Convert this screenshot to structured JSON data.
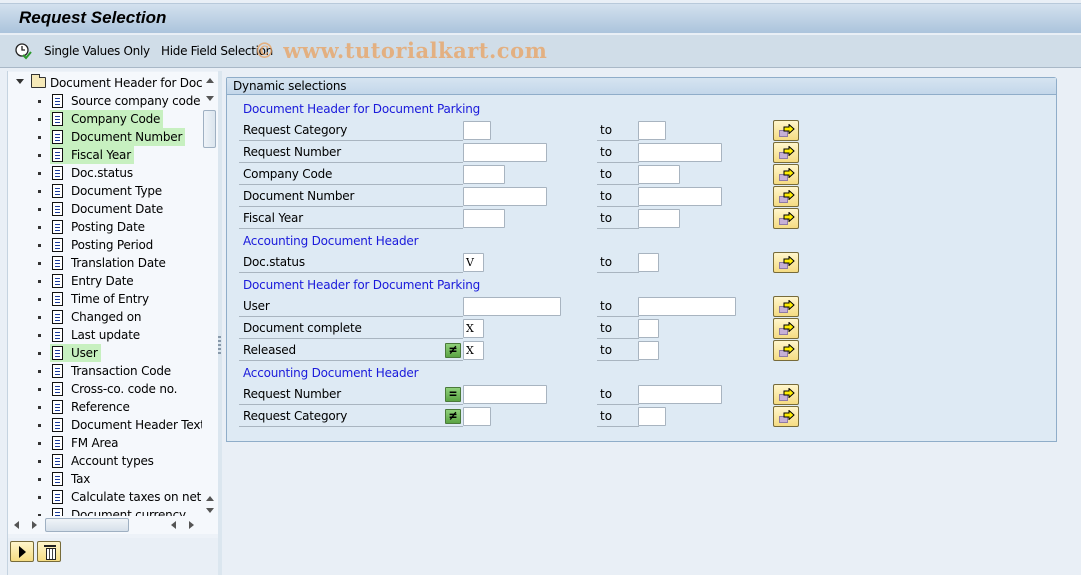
{
  "window": {
    "title": "Request Selection"
  },
  "toolbar": {
    "items": [
      {
        "label": "Single Values Only",
        "icon": "clock-check-icon"
      },
      {
        "label": "Hide Field Selection"
      }
    ],
    "watermark": "© www.tutorialkart.com"
  },
  "tree": {
    "root": {
      "label": "Document Header for Docu",
      "expanded": true
    },
    "items": [
      {
        "label": "Source company code",
        "selected": false
      },
      {
        "label": "Company Code",
        "selected": true
      },
      {
        "label": "Document Number",
        "selected": true
      },
      {
        "label": "Fiscal Year",
        "selected": true
      },
      {
        "label": "Doc.status",
        "selected": false
      },
      {
        "label": "Document Type",
        "selected": false
      },
      {
        "label": "Document Date",
        "selected": false
      },
      {
        "label": "Posting Date",
        "selected": false
      },
      {
        "label": "Posting Period",
        "selected": false
      },
      {
        "label": "Translation Date",
        "selected": false
      },
      {
        "label": "Entry Date",
        "selected": false
      },
      {
        "label": "Time of Entry",
        "selected": false
      },
      {
        "label": "Changed on",
        "selected": false
      },
      {
        "label": "Last update",
        "selected": false
      },
      {
        "label": "User",
        "selected": true
      },
      {
        "label": "Transaction Code",
        "selected": false
      },
      {
        "label": "Cross-co. code no.",
        "selected": false
      },
      {
        "label": "Reference",
        "selected": false
      },
      {
        "label": "Document Header Text",
        "selected": false
      },
      {
        "label": "FM Area",
        "selected": false
      },
      {
        "label": "Account types",
        "selected": false
      },
      {
        "label": "Tax",
        "selected": false
      },
      {
        "label": "Calculate taxes on net a",
        "selected": false
      },
      {
        "label": "Document currency",
        "selected": false
      }
    ],
    "buttons": {
      "apply": "execute-icon",
      "delete": "trash-icon"
    }
  },
  "dynamic_selections": {
    "title": "Dynamic selections",
    "to_label": "to",
    "rows": [
      {
        "type": "group",
        "label": "Document Header for Document Parking"
      },
      {
        "type": "field",
        "label": "Request Category",
        "low": "",
        "high": "",
        "size": "xs",
        "op": null
      },
      {
        "type": "field",
        "label": "Request Number",
        "low": "",
        "high": "",
        "size": "l",
        "op": null
      },
      {
        "type": "field",
        "label": "Company Code",
        "low": "",
        "high": "",
        "size": "s",
        "op": null
      },
      {
        "type": "field",
        "label": "Document Number",
        "low": "",
        "high": "",
        "size": "l",
        "op": null
      },
      {
        "type": "field",
        "label": "Fiscal Year",
        "low": "",
        "high": "",
        "size": "s",
        "op": null
      },
      {
        "type": "group",
        "label": "Accounting Document Header"
      },
      {
        "type": "field",
        "label": "Doc.status",
        "low": "V",
        "high": "",
        "size": "xxs",
        "op": null
      },
      {
        "type": "group",
        "label": "Document Header for Document Parking"
      },
      {
        "type": "field",
        "label": "User",
        "low": "",
        "high": "",
        "size": "xl",
        "op": null
      },
      {
        "type": "field",
        "label": "Document complete",
        "low": "X",
        "high": "",
        "size": "xxs",
        "op": null
      },
      {
        "type": "field",
        "label": "Released",
        "low": "X",
        "high": "",
        "size": "xxs",
        "op": "≠"
      },
      {
        "type": "group",
        "label": "Accounting Document Header"
      },
      {
        "type": "field",
        "label": "Request Number",
        "low": "",
        "high": "",
        "size": "l",
        "op": "="
      },
      {
        "type": "field",
        "label": "Request Category",
        "low": "",
        "high": "",
        "size": "xs",
        "op": "≠"
      }
    ]
  }
}
